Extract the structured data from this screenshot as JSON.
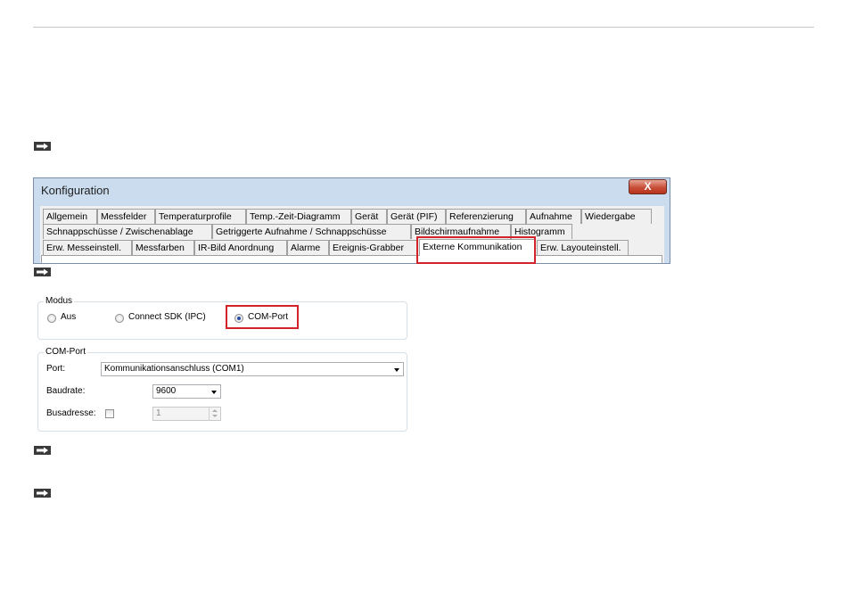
{
  "window": {
    "title": "Konfiguration",
    "close_glyph": "X"
  },
  "tabs": {
    "row1": [
      "Allgemein",
      "Messfelder",
      "Temperaturprofile",
      "Temp.-Zeit-Diagramm",
      "Gerät",
      "Gerät (PIF)",
      "Referenzierung",
      "Aufnahme",
      "Wiedergabe"
    ],
    "row2": [
      "Schnappschüsse / Zwischenablage",
      "Getriggerte Aufnahme / Schnappschüsse",
      "Bildschirmaufnahme",
      "Histogramm"
    ],
    "row3": [
      "Erw. Messeinstell.",
      "Messfarben",
      "IR-Bild Anordnung",
      "Alarme",
      "Ereignis-Grabber",
      "Externe Kommunikation",
      "Erw. Layouteinstell."
    ],
    "active": "Externe Kommunikation"
  },
  "modus": {
    "legend": "Modus",
    "options": [
      "Aus",
      "Connect SDK (IPC)",
      "COM-Port"
    ],
    "selected": "COM-Port"
  },
  "com_port": {
    "legend": "COM-Port",
    "port_label": "Port:",
    "port_value": "Kommunikationsanschluss (COM1)",
    "baudrate_label": "Baudrate:",
    "baudrate_value": "9600",
    "busadresse_label": "Busadresse:",
    "busadresse_checked": false,
    "busadresse_value": "1"
  },
  "icons": [
    "arrow-right-icon",
    "chevron-down-icon",
    "close-icon"
  ],
  "colors": {
    "highlight": "#d2232a",
    "window_frame": "#cbdcef",
    "close_button": "#c7503a"
  }
}
